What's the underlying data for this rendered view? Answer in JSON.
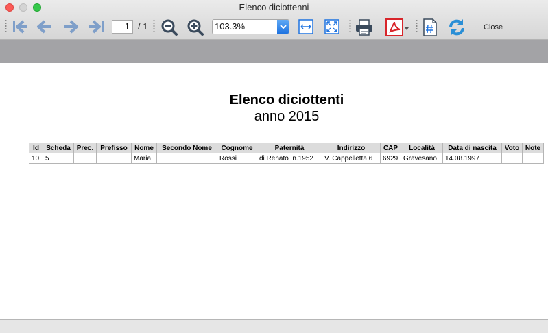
{
  "window": {
    "title": "Elenco diciottenni"
  },
  "toolbar": {
    "page_current": "1",
    "page_total": "/ 1",
    "zoom_value": "103.3%",
    "close_label": "Close"
  },
  "report": {
    "title": "Elenco diciottenti",
    "subtitle": "anno 2015",
    "columns": [
      "Id",
      "Scheda",
      "Prec.",
      "Prefisso",
      "Nome",
      "Secondo Nome",
      "Cognome",
      "Paternità",
      "Indirizzo",
      "CAP",
      "Località",
      "Data di nascita",
      "Voto",
      "Note"
    ],
    "rows": [
      [
        "10",
        "5",
        "",
        "",
        "Maria",
        "",
        "Rossi",
        "di Renato  n.1952",
        "V. Cappelletta 6",
        "6929",
        "Gravesano",
        "14.08.1997",
        "",
        ""
      ]
    ]
  },
  "colors": {
    "nav_arrow": "#7f9fc9",
    "zoom_icon": "#3a4a5c",
    "accent_blue": "#1e73e0",
    "pdf_red": "#d8252a",
    "band_grey": "#a3a3a6"
  }
}
